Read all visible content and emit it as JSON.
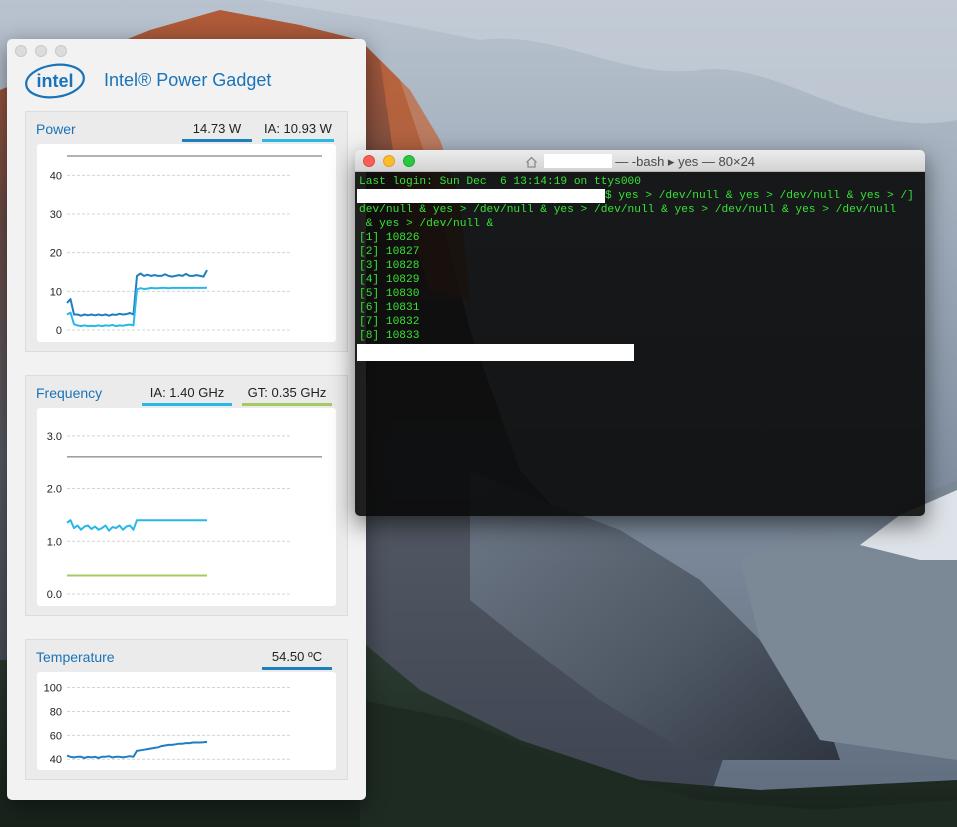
{
  "power_gadget": {
    "title": "Intel® Power Gadget",
    "logo_text": "intel",
    "colors": {
      "accent": "#1a73b8",
      "package": "#1f7ec0",
      "ia": "#29b8e6",
      "gt": "#a5c963",
      "limit": "#666666"
    },
    "power": {
      "label": "Power",
      "package_value": "14.73 W",
      "ia_value": "IA: 10.93 W",
      "y_ticks": [
        "40",
        "30",
        "20",
        "10",
        "0"
      ]
    },
    "frequency": {
      "label": "Frequency",
      "ia_value": "IA: 1.40 GHz",
      "gt_value": "GT: 0.35 GHz",
      "y_ticks": [
        "3.0",
        "2.0",
        "1.0",
        "0.0"
      ]
    },
    "temperature": {
      "label": "Temperature",
      "value": "54.50 ºC",
      "y_ticks": [
        "100",
        "80",
        "60",
        "40"
      ]
    }
  },
  "chart_data": [
    {
      "type": "line",
      "title": "Power",
      "ylim": [
        0,
        45
      ],
      "y_ticks": [
        0,
        10,
        20,
        30,
        40
      ],
      "grid": true,
      "limit_line": 45,
      "series": [
        {
          "name": "14.73 W",
          "x": [
            0,
            1,
            2,
            3,
            4,
            5,
            6,
            7,
            8,
            9,
            10,
            11,
            12,
            13,
            14,
            15,
            16,
            17,
            18,
            19,
            20,
            21,
            22,
            23,
            24,
            25,
            26,
            27,
            28,
            29,
            30,
            31,
            32,
            33,
            34,
            35,
            36,
            37,
            38,
            39,
            40
          ],
          "values": [
            7,
            8,
            4,
            4,
            3.7,
            4,
            3.8,
            4,
            3.8,
            4,
            3.8,
            4,
            3.7,
            4,
            3.9,
            4.2,
            4,
            4.1,
            4.4,
            4,
            14,
            14.6,
            14,
            14.3,
            14,
            14.2,
            14,
            14,
            14.4,
            14,
            13.8,
            14,
            14.2,
            14,
            14.5,
            14,
            14,
            14.2,
            14,
            13.8,
            15.5
          ]
        },
        {
          "name": "IA: 10.93 W",
          "x": [
            0,
            1,
            2,
            3,
            4,
            5,
            6,
            7,
            8,
            9,
            10,
            11,
            12,
            13,
            14,
            15,
            16,
            17,
            18,
            19,
            20,
            21,
            22,
            23,
            24,
            25,
            26,
            27,
            28,
            29,
            30,
            31,
            32,
            33,
            34,
            35,
            36,
            37,
            38,
            39,
            40
          ],
          "values": [
            4,
            4.5,
            1.5,
            1.2,
            1,
            1.2,
            1,
            1.1,
            1,
            1.2,
            1,
            1.2,
            1.1,
            1.3,
            1,
            1.2,
            1.1,
            1.3,
            1.4,
            1.2,
            10.5,
            10.8,
            10.6,
            10.7,
            10.9,
            10.8,
            10.8,
            10.9,
            10.9,
            10.8,
            10.9,
            10.9,
            10.9,
            10.9,
            10.9,
            10.9,
            10.9,
            10.9,
            10.9,
            10.9,
            10.93
          ]
        }
      ]
    },
    {
      "type": "line",
      "title": "Frequency",
      "ylim": [
        0,
        3.3
      ],
      "y_ticks": [
        0,
        1,
        2,
        3
      ],
      "grid": true,
      "limit_line": 2.6,
      "series": [
        {
          "name": "IA: 1.40 GHz",
          "x": [
            0,
            1,
            2,
            3,
            4,
            5,
            6,
            7,
            8,
            9,
            10,
            11,
            12,
            13,
            14,
            15,
            16,
            17,
            18,
            19,
            20,
            21,
            22,
            23,
            24,
            25,
            26,
            27,
            28,
            29,
            30,
            31,
            32,
            33,
            34,
            35,
            36,
            37,
            38,
            39,
            40
          ],
          "values": [
            1.35,
            1.4,
            1.25,
            1.3,
            1.22,
            1.28,
            1.3,
            1.23,
            1.28,
            1.22,
            1.25,
            1.3,
            1.2,
            1.27,
            1.25,
            1.3,
            1.22,
            1.28,
            1.3,
            1.22,
            1.4,
            1.4,
            1.4,
            1.4,
            1.4,
            1.4,
            1.4,
            1.4,
            1.4,
            1.4,
            1.4,
            1.4,
            1.4,
            1.4,
            1.4,
            1.4,
            1.4,
            1.4,
            1.4,
            1.4,
            1.4
          ]
        },
        {
          "name": "GT: 0.35 GHz",
          "x": [
            0,
            40
          ],
          "values": [
            0.35,
            0.35
          ]
        }
      ]
    },
    {
      "type": "line",
      "title": "Temperature",
      "ylim": [
        36,
        108
      ],
      "y_ticks": [
        40,
        60,
        80,
        100
      ],
      "grid": true,
      "series": [
        {
          "name": "54.50 ºC",
          "x": [
            0,
            1,
            2,
            3,
            4,
            5,
            6,
            7,
            8,
            9,
            10,
            11,
            12,
            13,
            14,
            15,
            16,
            17,
            18,
            19,
            20,
            21,
            22,
            23,
            24,
            25,
            26,
            27,
            28,
            29,
            30,
            31,
            32,
            33,
            34,
            35,
            36,
            37,
            38,
            39,
            40
          ],
          "values": [
            43,
            42,
            41.5,
            42,
            42,
            41,
            42,
            41.5,
            42,
            41,
            42,
            42,
            42.5,
            41.5,
            42,
            42,
            41.5,
            42,
            42.5,
            42,
            47,
            47.5,
            48,
            48.5,
            49,
            49.5,
            50,
            51,
            51.5,
            52,
            52,
            52.5,
            53,
            53,
            53.5,
            53.5,
            54,
            54,
            54,
            54.2,
            54.5
          ]
        }
      ]
    }
  ],
  "terminal": {
    "title_user": "",
    "title_text": "— -bash ▸ yes — 80×24",
    "lines": [
      "Last login: Sun Dec  6 13:14:19 on ttys000",
      "$ yes > /dev/null & yes > /dev/null & yes > /]",
      "dev/null & yes > /dev/null & yes > /dev/null & yes > /dev/null & yes > /dev/null",
      " & yes > /dev/null &",
      "[1] 10826",
      "[2] 10827",
      "[3] 10828",
      "[4] 10829",
      "[5] 10830",
      "[6] 10831",
      "[7] 10832",
      "[8] 10833"
    ],
    "colors": {
      "text": "#37e337",
      "background": "#080808"
    }
  }
}
